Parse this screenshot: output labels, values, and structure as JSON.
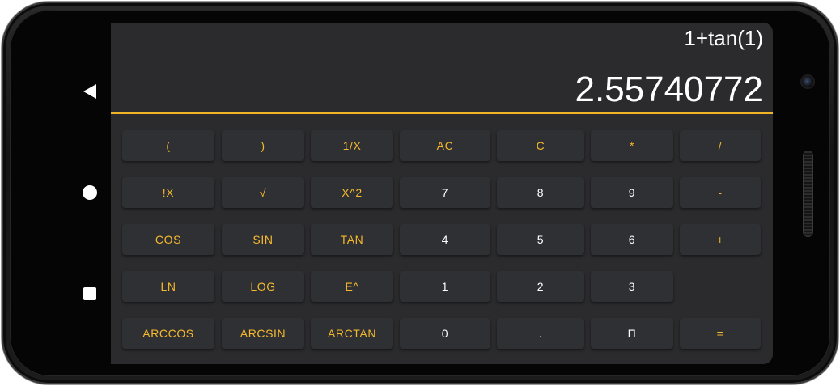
{
  "display": {
    "expression": "1+tan(1)",
    "result": "2.55740772"
  },
  "colors": {
    "accent": "#f5b82e",
    "divider": "#f0b429",
    "background": "#2b2b2e",
    "key_background": "#2f3033",
    "digit_text": "#ffffff"
  },
  "nav": {
    "back": "back-icon",
    "home": "home-icon",
    "recents": "recents-icon"
  },
  "keys": {
    "open_paren": "(",
    "close_paren": ")",
    "reciprocal": "1/X",
    "all_clear": "AC",
    "clear": "C",
    "multiply": "*",
    "divide": "/",
    "factorial": "!X",
    "sqrt": "√",
    "square": "X^2",
    "seven": "7",
    "eight": "8",
    "nine": "9",
    "minus": "-",
    "cos": "COS",
    "sin": "SIN",
    "tan": "TAN",
    "four": "4",
    "five": "5",
    "six": "6",
    "plus": "+",
    "ln": "LN",
    "log": "LOG",
    "exp": "E^",
    "one": "1",
    "two": "2",
    "three": "3",
    "arccos": "ARCCOS",
    "arcsin": "ARCSIN",
    "arctan": "ARCTAN",
    "zero": "0",
    "decimal": ".",
    "pi": "Π",
    "equals": "="
  }
}
